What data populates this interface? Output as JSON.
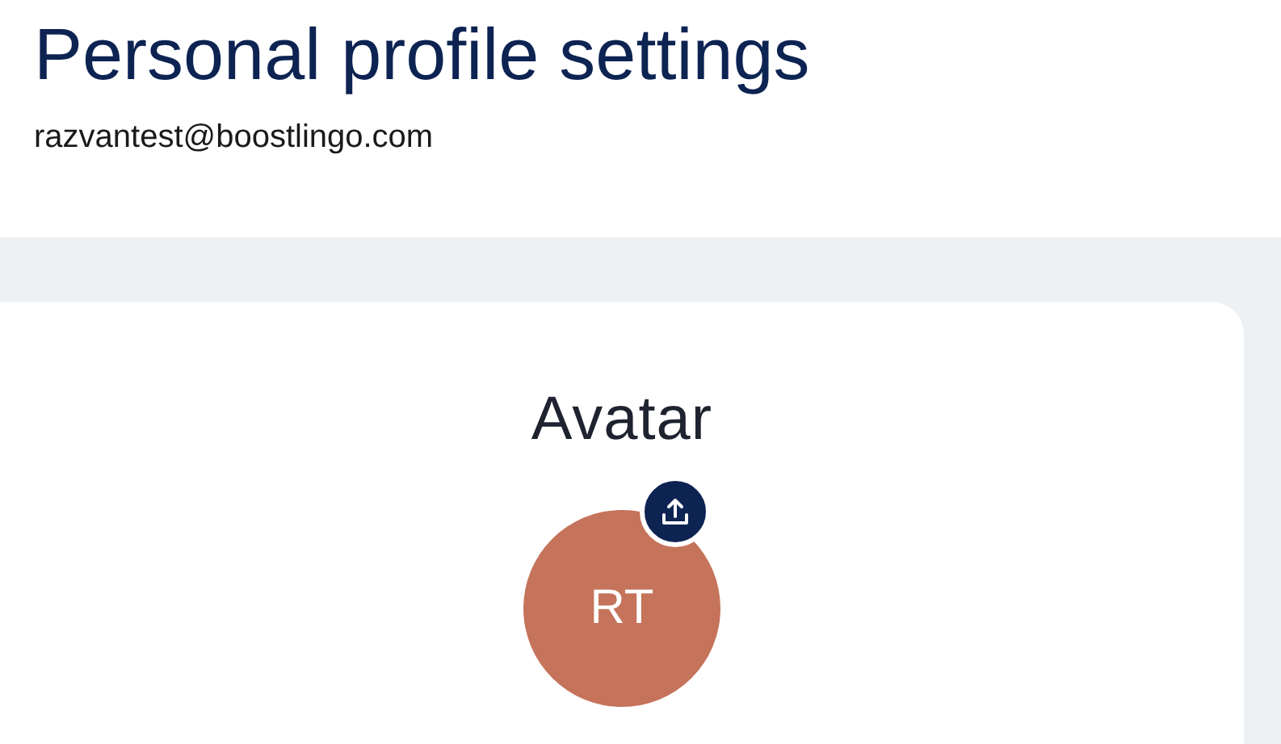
{
  "header": {
    "title": "Personal profile settings",
    "email": "razvantest@boostlingo.com"
  },
  "avatar_card": {
    "heading": "Avatar",
    "initials": "RT",
    "color": "#c5735b"
  }
}
